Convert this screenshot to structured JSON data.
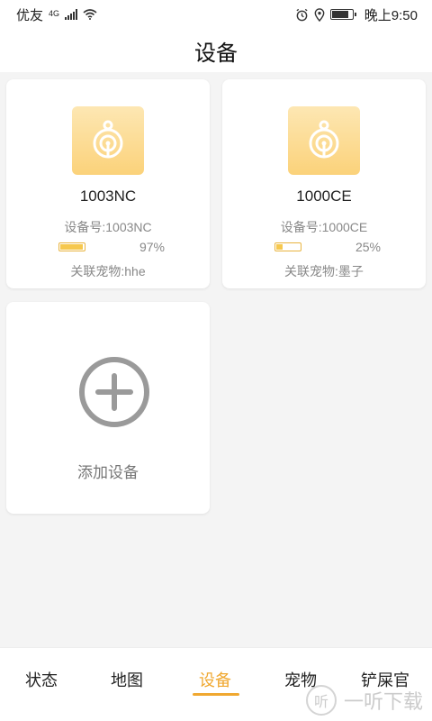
{
  "status_bar": {
    "carrier": "优友",
    "network": "4G",
    "time": "晚上9:50"
  },
  "header": {
    "title": "设备"
  },
  "devices": [
    {
      "name": "1003NC",
      "id_label": "设备号:1003NC",
      "battery_percent_text": "97%",
      "battery_level": 0.97,
      "pet_label": "关联宠物:hhe"
    },
    {
      "name": "1000CE",
      "id_label": "设备号:1000CE",
      "battery_percent_text": "25%",
      "battery_level": 0.25,
      "pet_label": "关联宠物:墨子"
    }
  ],
  "add_device": {
    "label": "添加设备"
  },
  "tabs": [
    {
      "label": "状态",
      "active": false
    },
    {
      "label": "地图",
      "active": false
    },
    {
      "label": "设备",
      "active": true
    },
    {
      "label": "宠物",
      "active": false
    },
    {
      "label": "铲屎官",
      "active": false
    }
  ],
  "watermark": {
    "text": "一听下载",
    "logo": "听"
  },
  "colors": {
    "accent": "#f0a830",
    "icon_gradient_top": "#fde7b3",
    "icon_gradient_bottom": "#fbd27a",
    "background": "#f4f4f4"
  },
  "icons": {
    "device": "tracker-icon",
    "add": "plus-circle-icon",
    "alarm": "alarm-icon",
    "location": "location-icon",
    "wifi": "wifi-icon",
    "battery": "battery-icon"
  }
}
